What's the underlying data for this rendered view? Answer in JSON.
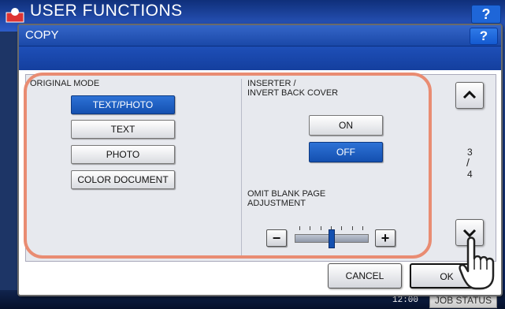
{
  "background": {
    "title": "USER FUNCTIONS",
    "help_label": "?",
    "clock": "12:00",
    "job_status_label": "JOB STATUS"
  },
  "dialog": {
    "title": "COPY",
    "help_label": "?"
  },
  "original_mode": {
    "label": "ORIGINAL MODE",
    "options": [
      "TEXT/PHOTO",
      "TEXT",
      "PHOTO",
      "COLOR DOCUMENT"
    ],
    "selected": "TEXT/PHOTO"
  },
  "inserter": {
    "label_line1": "INSERTER /",
    "label_line2": "INVERT BACK COVER",
    "on_label": "ON",
    "off_label": "OFF",
    "selected": "OFF"
  },
  "omit_blank": {
    "label_line1": "OMIT BLANK PAGE",
    "label_line2": "ADJUSTMENT",
    "minus_label": "−",
    "plus_label": "+",
    "level": 4,
    "levels": 7
  },
  "pager": {
    "current": "3",
    "separator": "/",
    "total": "4"
  },
  "footer": {
    "cancel_label": "CANCEL",
    "ok_label": "OK"
  },
  "colors": {
    "selected_button": "#1450b0",
    "highlight_outline": "#e98c72"
  }
}
